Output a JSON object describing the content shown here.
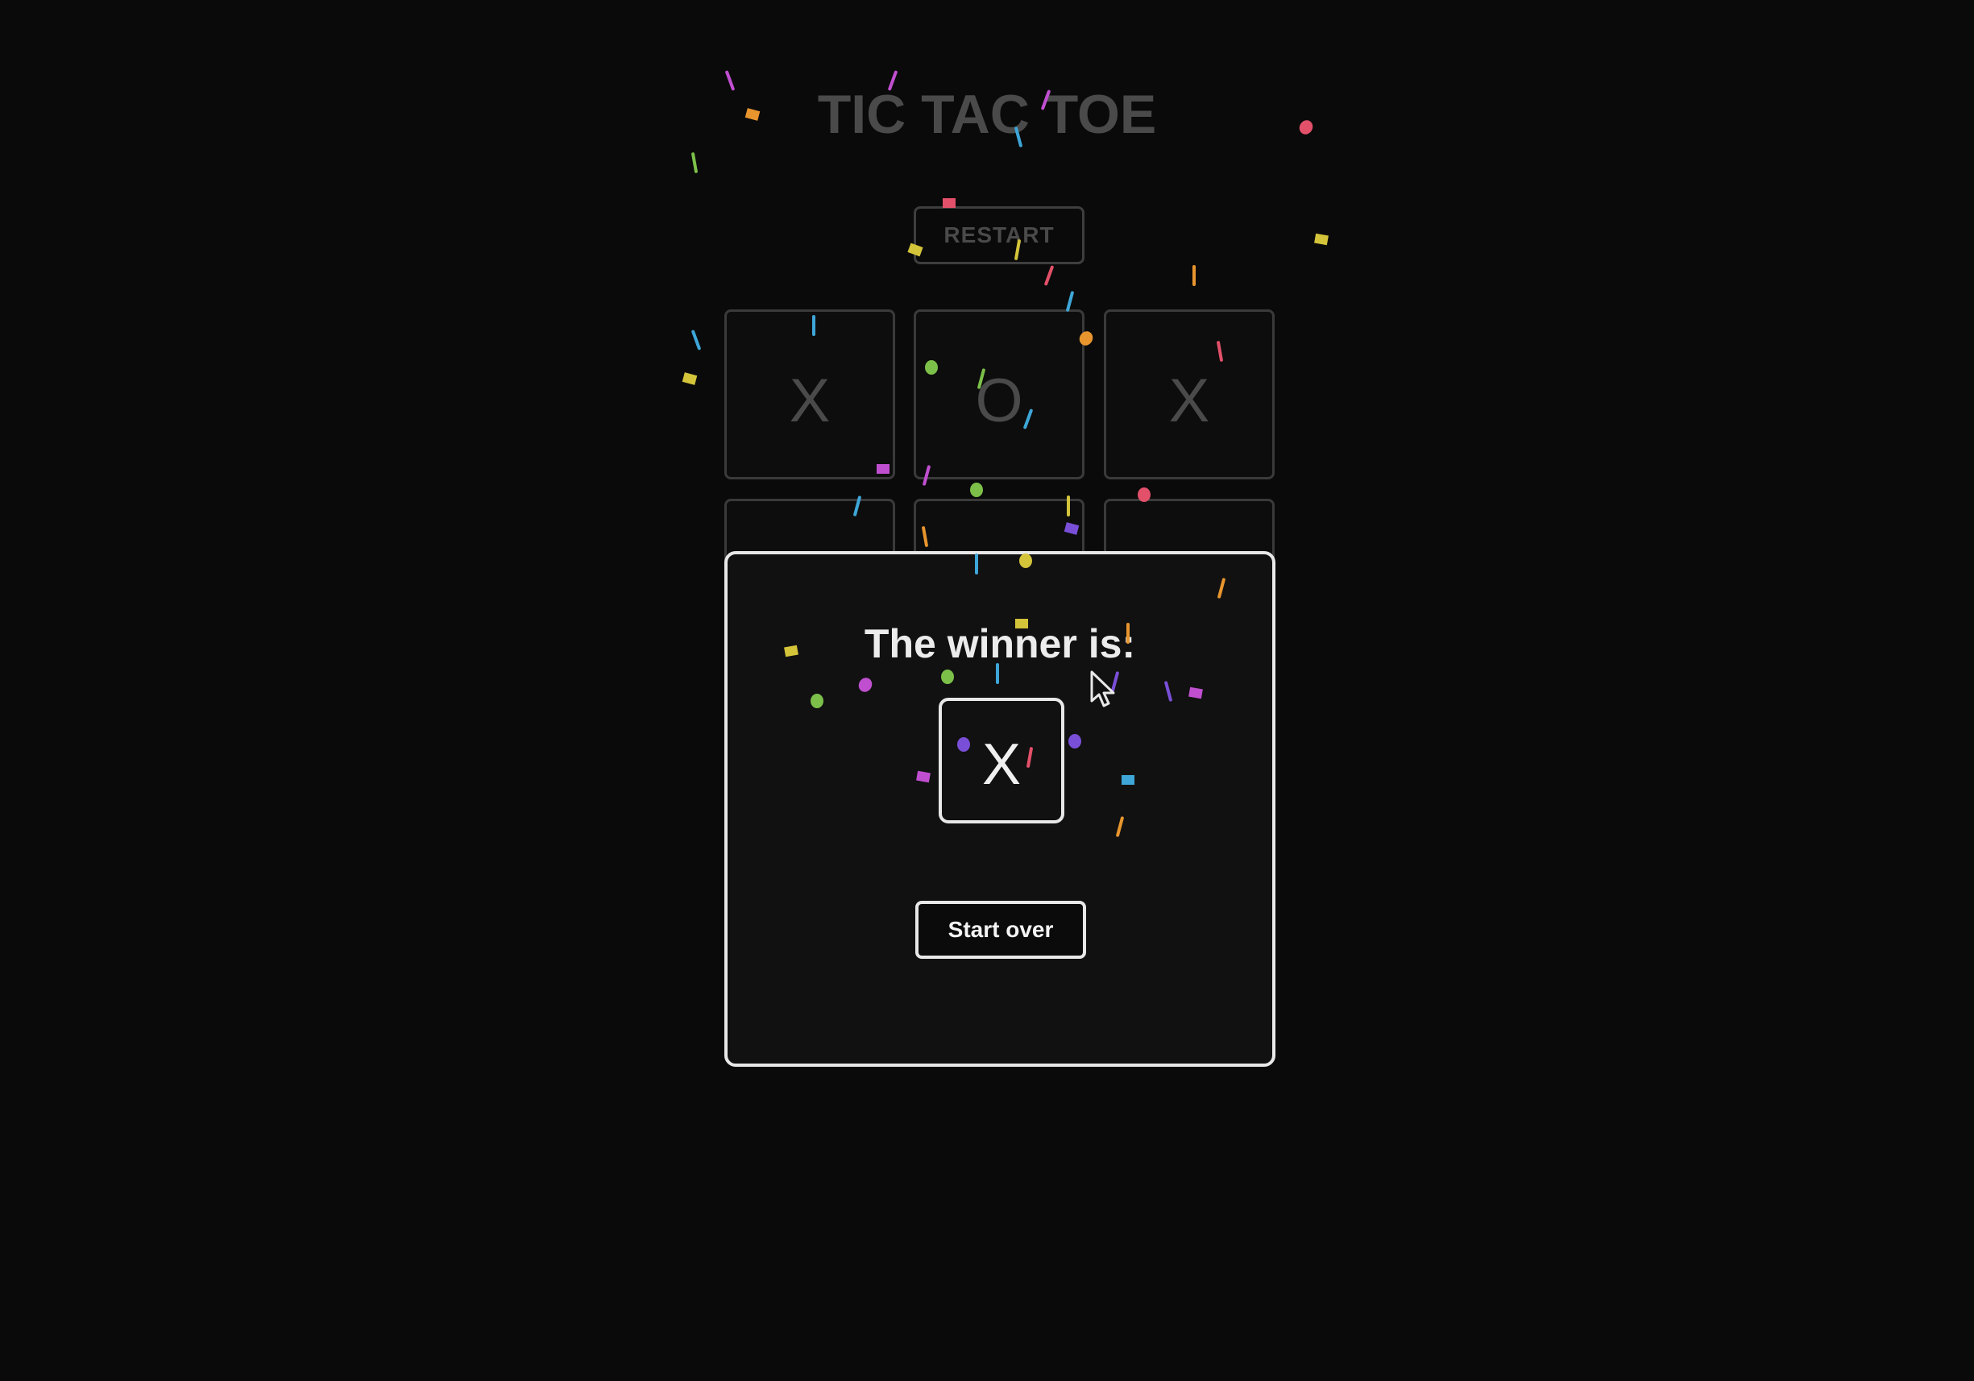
{
  "game": {
    "title": "TIC TAC TOE",
    "restart_label": "RESTART",
    "board": [
      "X",
      "O",
      "X",
      "",
      "",
      "",
      "",
      "",
      ""
    ]
  },
  "modal": {
    "title": "The winner is:",
    "winner": "X",
    "start_over_label": "Start over"
  },
  "colors": {
    "background": "#0a0a0a",
    "modal_background": "#111111",
    "modal_border": "#e8e8e8",
    "dimmed_text": "#4a4a4a",
    "confetti": [
      "#c04fd0",
      "#e8952e",
      "#7cc04a",
      "#3ea6d8",
      "#d4c43a",
      "#e2506a",
      "#7a4fd8"
    ]
  },
  "icons": {
    "cursor": "arrow-cursor-icon"
  }
}
